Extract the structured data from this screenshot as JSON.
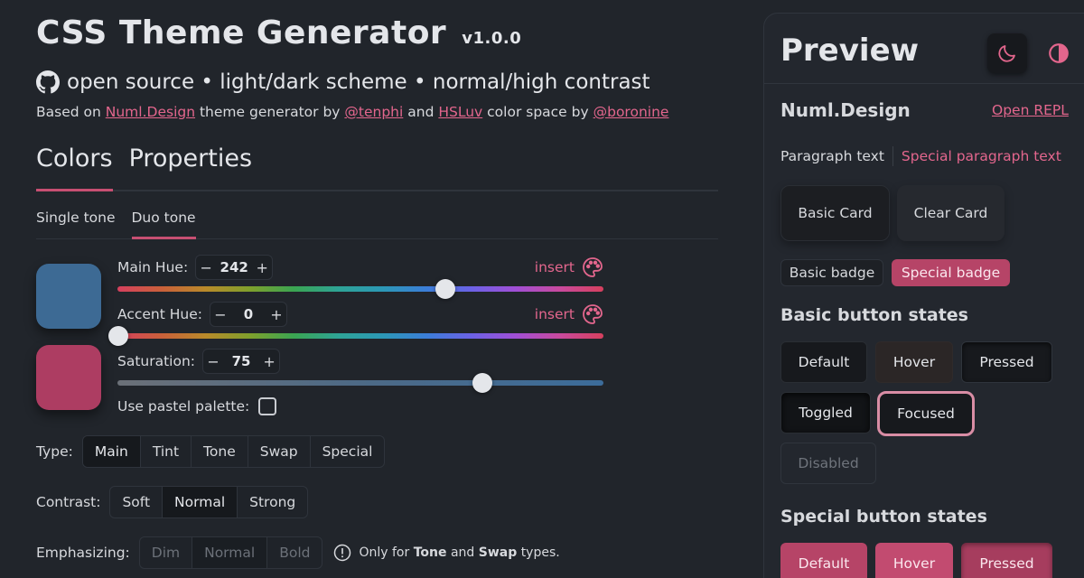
{
  "header": {
    "title": "CSS Theme Generator",
    "version": "v1.0.0",
    "subtitle": "open source • light/dark scheme • normal/high contrast",
    "credits": {
      "based_on": "Based on",
      "numl_link": "Numl.Design",
      "theme_generator_by": "theme generator by",
      "tenphi_link": "@tenphi",
      "and": "and",
      "hsluv_link": "HSLuv",
      "color_space_by": "color space by",
      "boronine_link": "@boronine"
    }
  },
  "main_tabs": [
    {
      "label": "Colors",
      "active": true
    },
    {
      "label": "Properties",
      "active": false
    }
  ],
  "sub_tabs": [
    {
      "label": "Single tone",
      "active": false
    },
    {
      "label": "Duo tone",
      "active": true
    }
  ],
  "swatches": {
    "main_color": "#3d6a94",
    "accent_color": "#ad3d62"
  },
  "controls": {
    "main_hue": {
      "label": "Main Hue:",
      "value": "242",
      "fraction": 0.6722
    },
    "accent_hue": {
      "label": "Accent Hue:",
      "value": "0",
      "fraction": 0.0
    },
    "saturation": {
      "label": "Saturation:",
      "value": "75",
      "fraction": 0.75
    },
    "insert_label": "insert",
    "minus": "−",
    "plus": "+",
    "pastel_label": "Use pastel palette:"
  },
  "type_row": {
    "label": "Type:",
    "options": [
      "Main",
      "Tint",
      "Tone",
      "Swap",
      "Special"
    ],
    "selected": "Main"
  },
  "contrast_row": {
    "label": "Contrast:",
    "options": [
      "Soft",
      "Normal",
      "Strong"
    ],
    "selected": "Normal"
  },
  "emphasizing_row": {
    "label": "Emphasizing:",
    "options": [
      "Dim",
      "Normal",
      "Bold"
    ],
    "selected": "Normal",
    "note_prefix": "Only for",
    "note_tone": "Tone",
    "note_and": "and",
    "note_swap": "Swap",
    "note_suffix": "types."
  },
  "preview": {
    "title": "Preview",
    "brand": "Numl.Design",
    "open_repl": "Open REPL",
    "paragraph_text": "Paragraph text",
    "special_paragraph_text": "Special paragraph text",
    "basic_card": "Basic Card",
    "clear_card": "Clear Card",
    "basic_badge": "Basic badge",
    "special_badge": "Special badge",
    "basic_states_heading": "Basic button states",
    "basic_buttons": {
      "default": "Default",
      "hover": "Hover",
      "pressed": "Pressed",
      "toggled": "Toggled",
      "focused": "Focused",
      "disabled": "Disabled"
    },
    "special_states_heading": "Special button states",
    "special_buttons": {
      "default": "Default",
      "hover": "Hover",
      "pressed": "Pressed"
    }
  },
  "icons": {
    "github": "github-icon",
    "palette": "palette-icon",
    "moon": "moon-icon",
    "contrast": "contrast-icon",
    "info": "info-icon"
  },
  "colors": {
    "background": "#21252b",
    "accent": "#e3668d",
    "accent_fill": "#b64467",
    "tab_indicator": "#c74f72"
  }
}
